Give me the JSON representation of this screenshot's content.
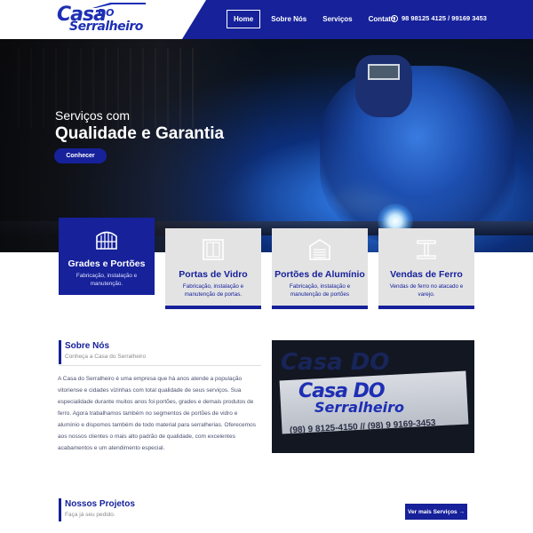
{
  "header": {
    "logo": {
      "word1": "Casa",
      "word2": "DO",
      "word3": "Serralheiro"
    },
    "nav": [
      {
        "label": "Home",
        "active": true
      },
      {
        "label": "Sobre Nós"
      },
      {
        "label": "Serviços"
      },
      {
        "label": "Contato"
      }
    ],
    "phone": "98 98125 4125 / 99169 3453",
    "phone_icon": "whatsapp-icon"
  },
  "hero": {
    "subtitle": "Serviços com",
    "title": "Qualidade e Garantia",
    "button": "Conhecer"
  },
  "services": [
    {
      "title": "Grades e Portões",
      "desc": "Fabricação, instalação e manutenção.",
      "icon": "gate-icon",
      "featured": true
    },
    {
      "title": "Portas de Vidro",
      "desc": "Fabricação, instalação e manutenção de portas.",
      "icon": "glass-door-icon"
    },
    {
      "title": "Portões de Alumínio",
      "desc": "Fabricação, instalação e manutenção de portões",
      "icon": "garage-door-icon"
    },
    {
      "title": "Vendas de Ferro",
      "desc": "Vendas de ferro no atacado e varejo.",
      "icon": "iron-beam-icon"
    }
  ],
  "about": {
    "title": "Sobre Nós",
    "subtitle": "Conheça a Casa do Serralheiro",
    "text": "A Casa do Serralheiro é uma empresa que há anos atende a população vitoriense e cidades vizinhas com total qualidade de seus serviços. Sua especialidade durante muitos anos foi portões, grades e demais produtos de ferro. Agora trabalhamos também no segmentos de portões de vidro e alumínio e dispomos também de todo material para serralherias. Oferecemos aos nossos clientes o mais alto padrão de qualidade, com excelentes acabamentos e um atendimento especial.",
    "image_sign": {
      "top": "Casa DO",
      "brand1": "Casa DO",
      "brand2": "Serralheiro",
      "phone": "(98) 9 8125-4150  //  (98) 9 9169-3453"
    }
  },
  "projects": {
    "title": "Nossos Projetos",
    "subtitle": "Faça já seu pedido.",
    "button": "Ver mais Serviços →"
  },
  "colors": {
    "primary": "#16219a",
    "card_bg": "#e3e3e3",
    "text_muted": "#8a8a8a"
  }
}
